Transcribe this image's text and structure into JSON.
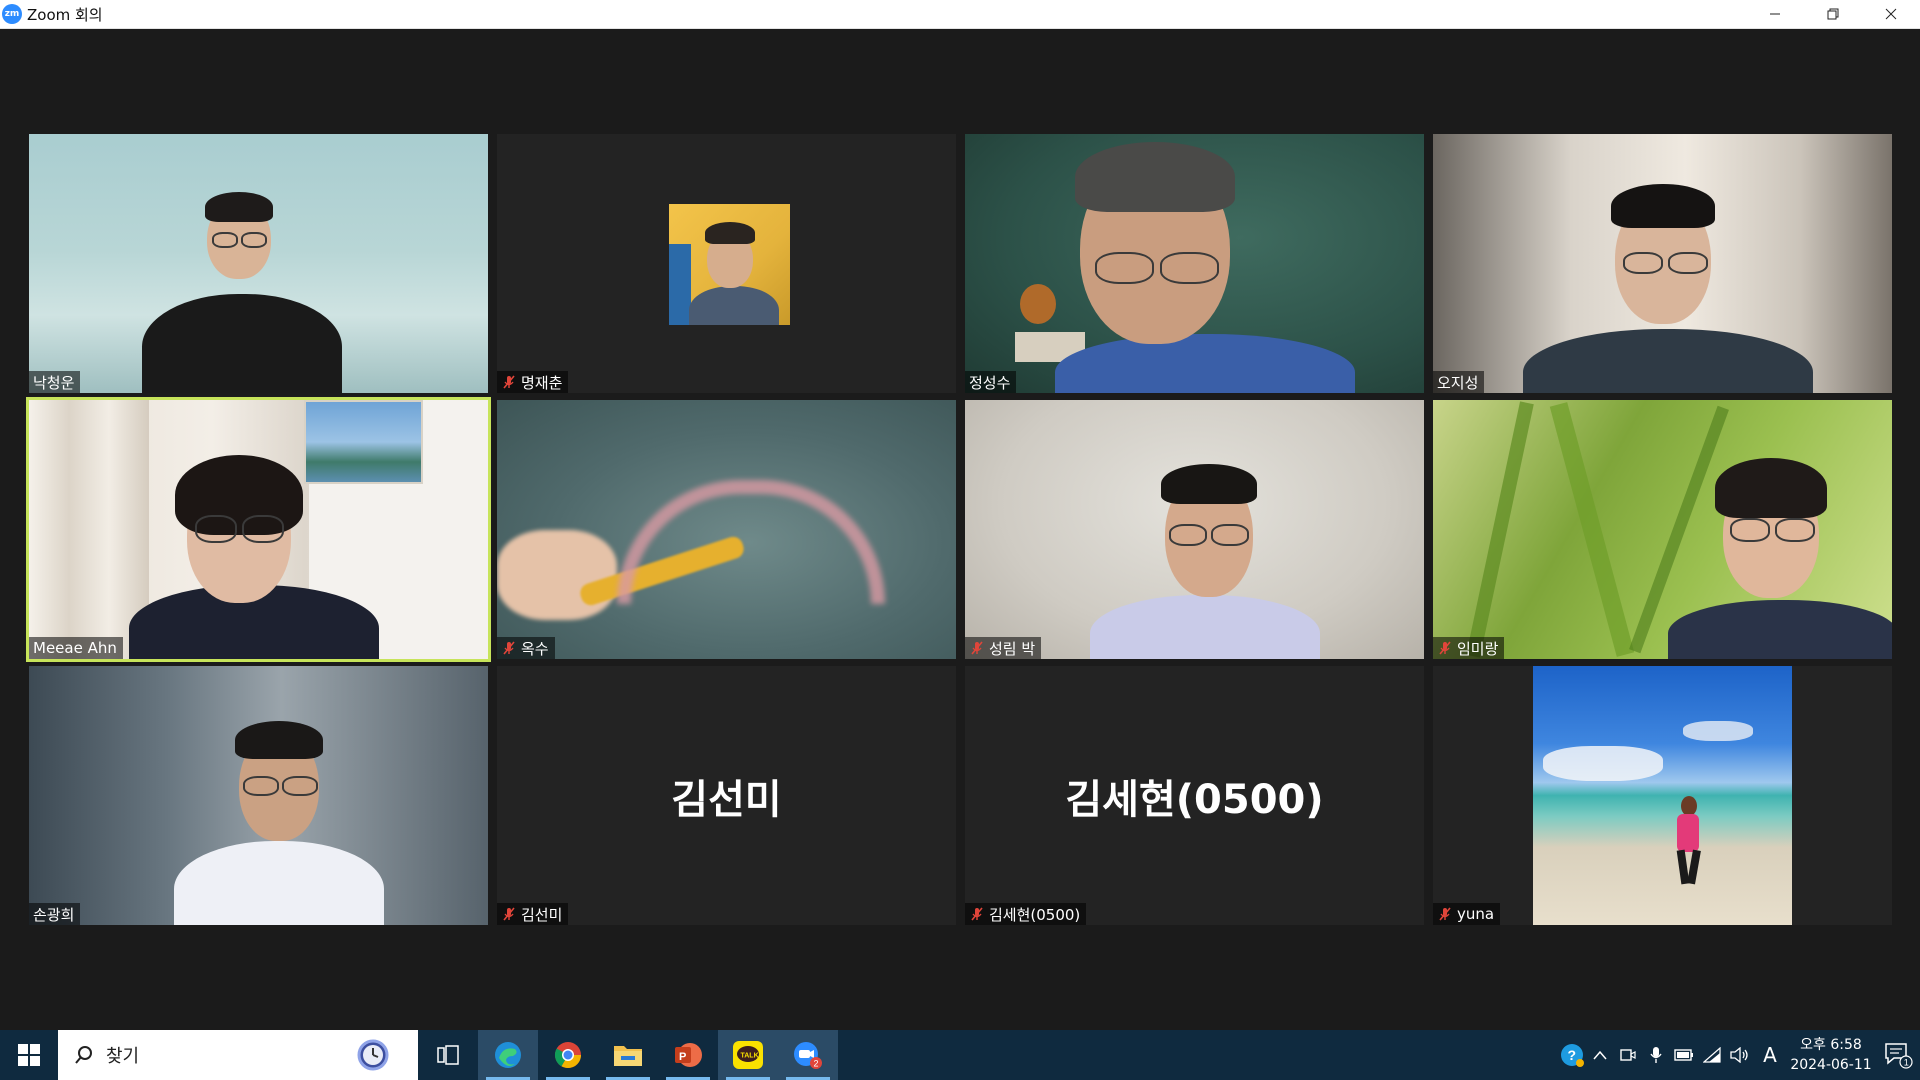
{
  "window": {
    "title": "Zoom 회의",
    "logo_text": "zm"
  },
  "participants": [
    {
      "name": "낙청운",
      "muted": false
    },
    {
      "name": "명재춘",
      "muted": true
    },
    {
      "name": "정성수",
      "muted": false
    },
    {
      "name": "오지성",
      "muted": false
    },
    {
      "name": "Meeae Ahn",
      "muted": false,
      "active_speaker": true
    },
    {
      "name": "옥수",
      "muted": true
    },
    {
      "name": "성림 박",
      "muted": true
    },
    {
      "name": "임미랑",
      "muted": true
    },
    {
      "name": "손광희",
      "muted": false
    },
    {
      "name": "김선미",
      "muted": true,
      "display_name_large": "김선미"
    },
    {
      "name": "김세현(0500)",
      "muted": true,
      "display_name_large": "김세현(0500)"
    },
    {
      "name": "yuna",
      "muted": true
    }
  ],
  "taskbar": {
    "search_label": "찾기",
    "apps": [
      "task-view",
      "edge",
      "chrome",
      "file-explorer",
      "powerpoint",
      "kakaotalk",
      "zoom"
    ],
    "zoom_badge": "2",
    "clock_time": "오후 6:58",
    "clock_date": "2024-06-11",
    "ime_label": "A",
    "notification_count": "1"
  },
  "colors": {
    "active_speaker_border": "#c7e45a",
    "muted_icon": "#e0453a",
    "taskbar": "#0f2a3f"
  }
}
